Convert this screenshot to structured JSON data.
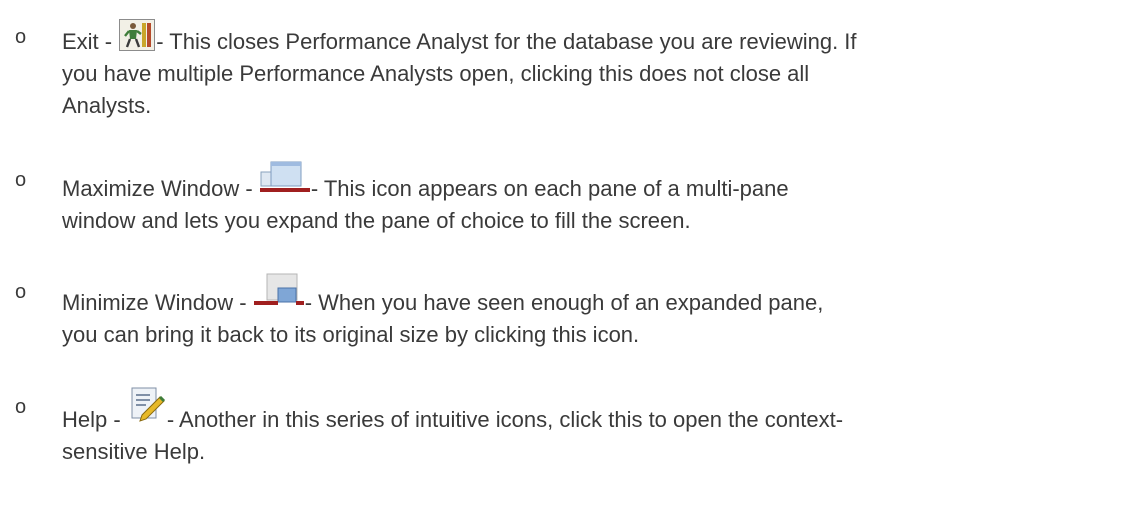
{
  "items": [
    {
      "term": "Exit -",
      "icon": "exit-icon",
      "lines": [
        "- This closes Performance Analyst for the database you are reviewing. If",
        "you have multiple Performance Analysts open, clicking this does not close all",
        "Analysts."
      ]
    },
    {
      "term": "Maximize Window -",
      "icon": "maximize-window-icon",
      "lines": [
        "- This icon appears on each pane of a multi-pane",
        "window and lets you expand the pane of choice to fill the screen."
      ]
    },
    {
      "term": "Minimize Window -",
      "icon": "minimize-window-icon",
      "lines": [
        "- When you have seen enough of an expanded pane,",
        "you can bring it back to its original size by clicking this icon."
      ]
    },
    {
      "term": "Help -",
      "icon": "help-icon",
      "lines": [
        "- Another in this series of intuitive icons, click this to open the context-",
        "sensitive Help."
      ]
    }
  ],
  "bullet_glyph": "o"
}
